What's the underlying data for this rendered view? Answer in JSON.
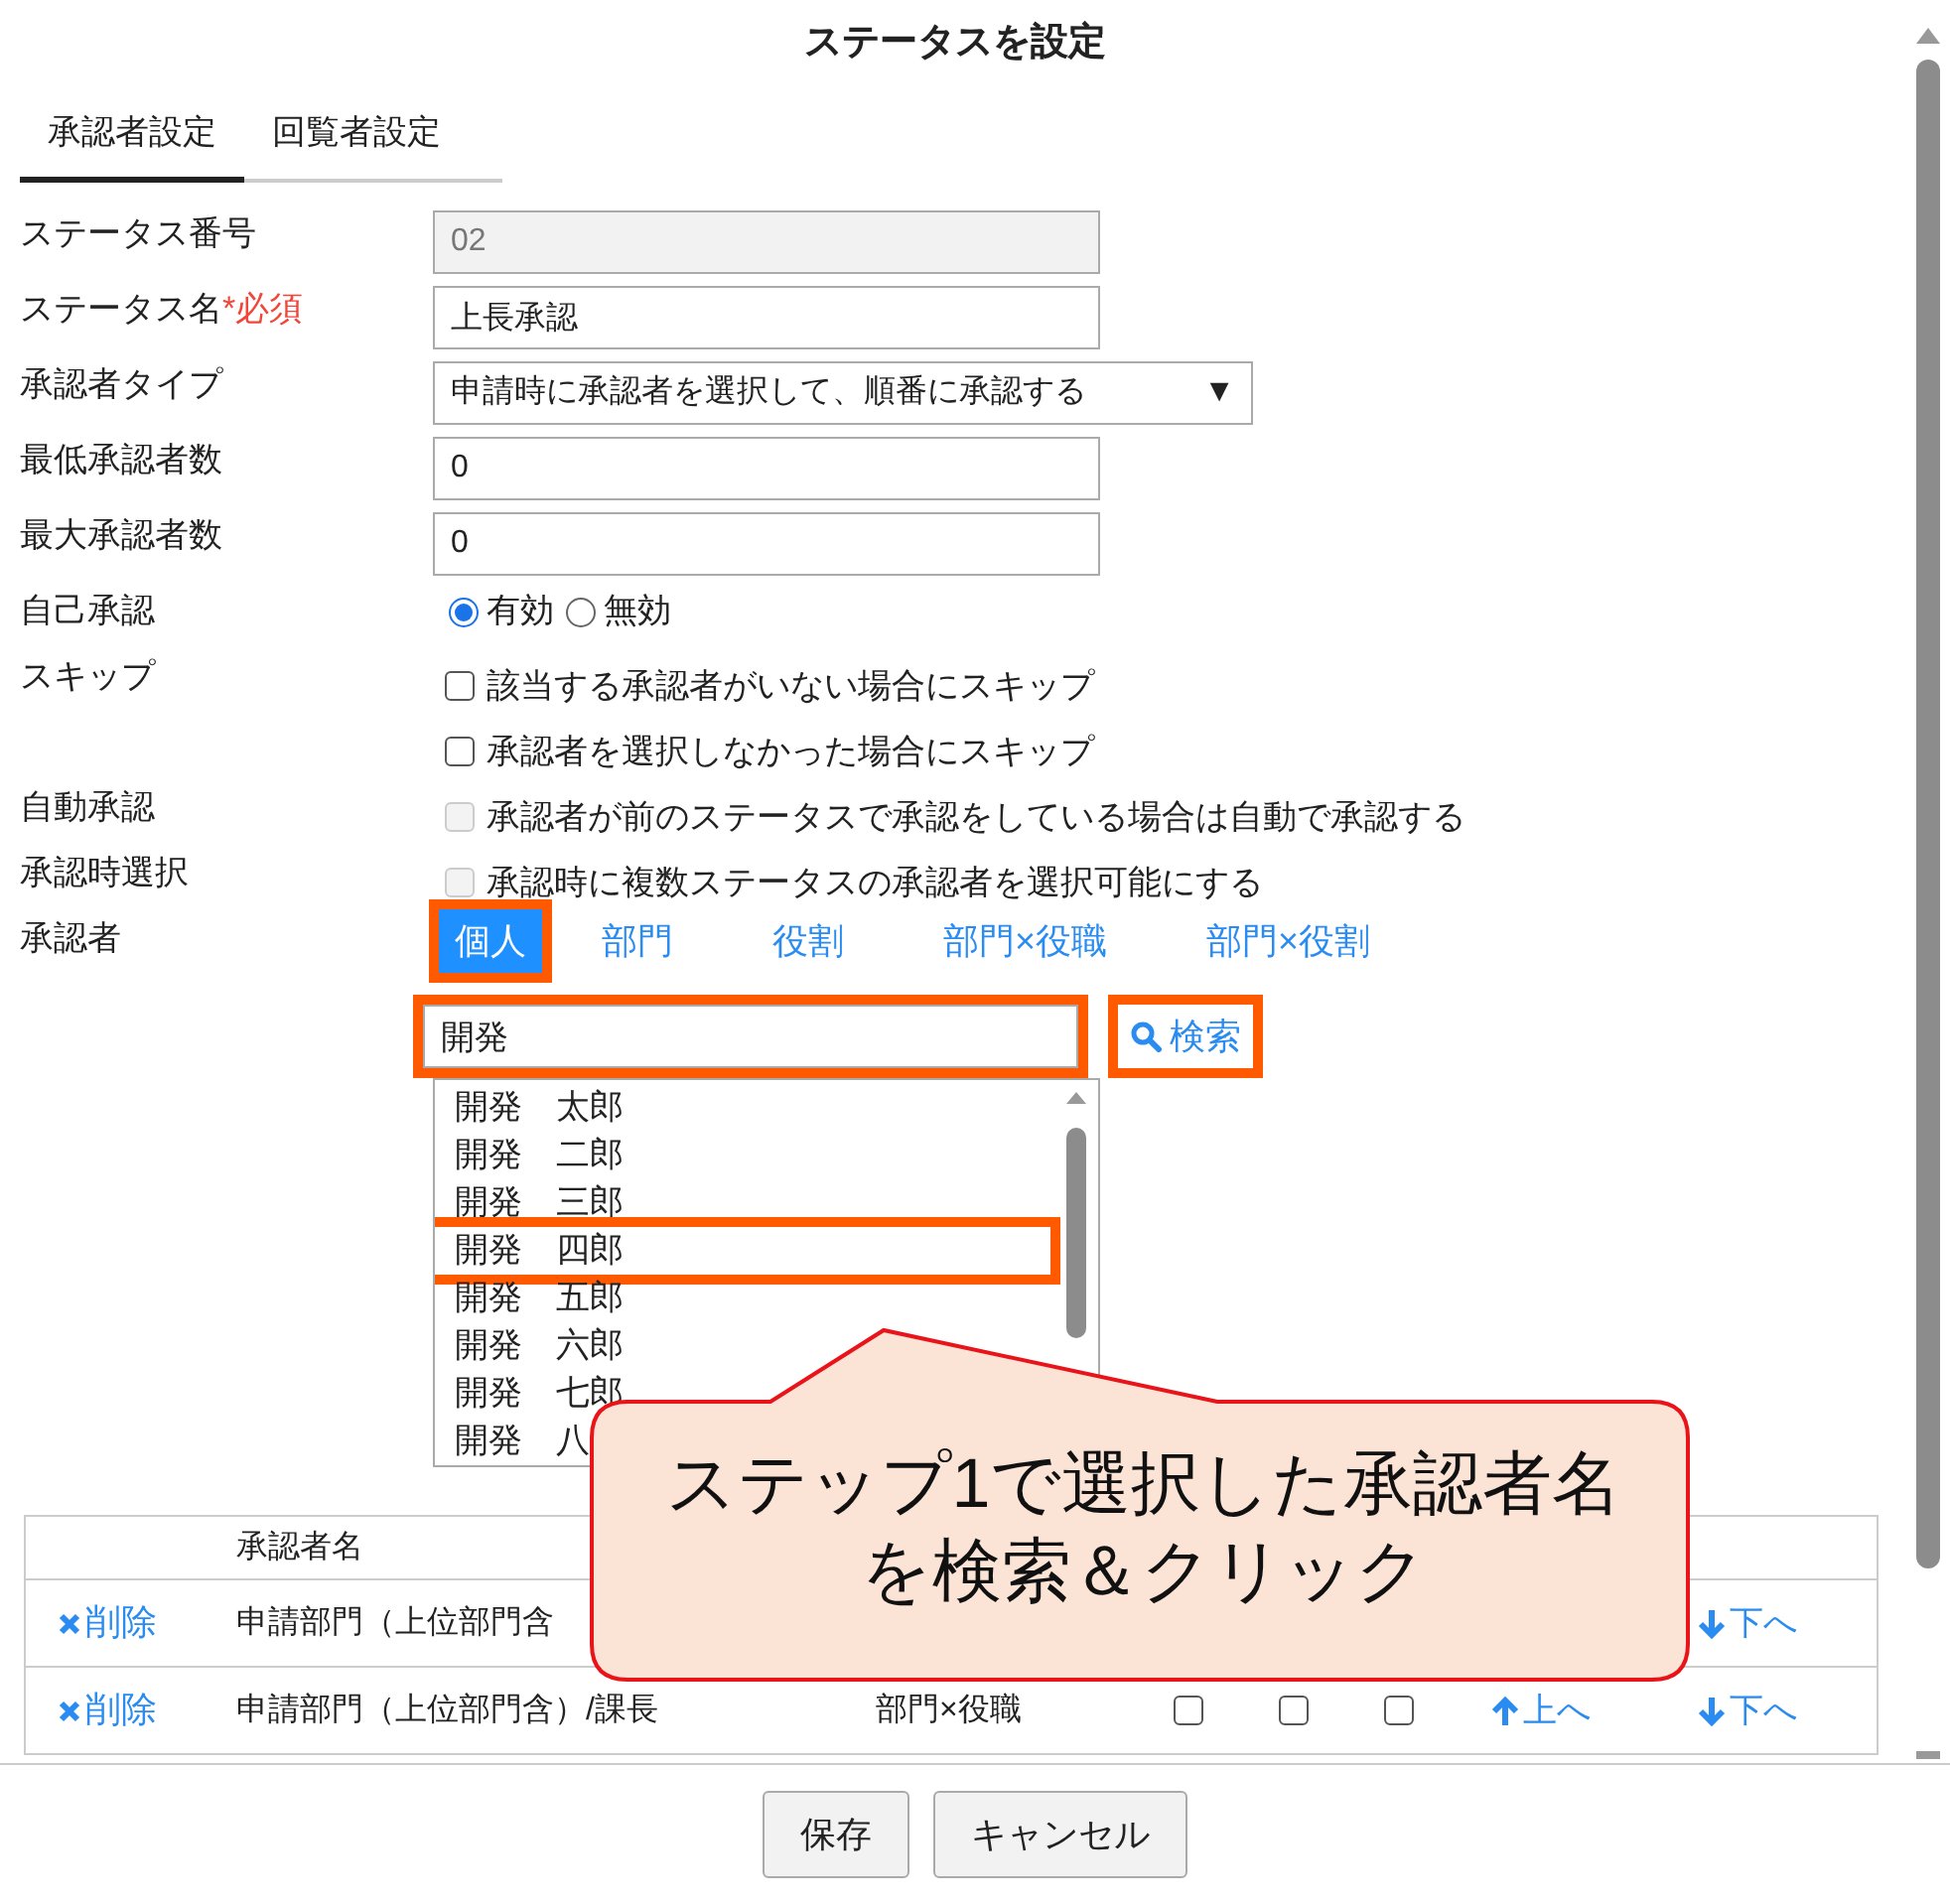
{
  "dialog": {
    "title": "ステータスを設定"
  },
  "tabs": [
    {
      "label": "承認者設定",
      "selected": true
    },
    {
      "label": "回覧者設定",
      "selected": false
    }
  ],
  "fields": [
    {
      "kind": "text",
      "label": "ステータス番号",
      "value": "02",
      "disabled": true
    },
    {
      "kind": "text",
      "label": "ステータス名",
      "required_mark": "*必須",
      "value": "上長承認",
      "disabled": false
    },
    {
      "kind": "select",
      "label": "承認者タイプ",
      "value": "申請時に承認者を選択して、順番に承認する",
      "arrow": "▼"
    },
    {
      "kind": "text",
      "label": "最低承認者数",
      "value": "0",
      "disabled": false
    },
    {
      "kind": "text",
      "label": "最大承認者数",
      "value": "0",
      "disabled": false
    },
    {
      "kind": "radio",
      "label": "自己承認",
      "options": [
        {
          "label": "有効",
          "selected": true
        },
        {
          "label": "無効",
          "selected": false
        }
      ]
    },
    {
      "kind": "checks",
      "label": "スキップ",
      "options": [
        {
          "label": "該当する承認者がいない場合にスキップ",
          "checked": false,
          "disabled": false
        },
        {
          "label": "承認者を選択しなかった場合にスキップ",
          "checked": false,
          "disabled": false
        }
      ]
    },
    {
      "kind": "checks",
      "label": "自動承認",
      "options": [
        {
          "label": "承認者が前のステータスで承認をしている場合は自動で承認する",
          "checked": false,
          "disabled": true
        }
      ]
    },
    {
      "kind": "checks",
      "label": "承認時選択",
      "options": [
        {
          "label": "承認時に複数ステータスの承認者を選択可能にする",
          "checked": false,
          "disabled": true
        }
      ]
    }
  ],
  "approver": {
    "label": "承認者",
    "tabs": [
      {
        "label": "個人",
        "selected": true,
        "highlighted": true
      },
      {
        "label": "部門",
        "selected": false,
        "highlighted": false
      },
      {
        "label": "役割",
        "selected": false,
        "highlighted": false
      },
      {
        "label": "部門×役職",
        "selected": false,
        "highlighted": false
      },
      {
        "label": "部門×役割",
        "selected": false,
        "highlighted": false
      }
    ],
    "search": {
      "value": "開発",
      "highlighted": true
    },
    "search_button": {
      "label": "検索",
      "highlighted": true
    },
    "results": [
      {
        "label": "開発　太郎",
        "highlighted": false
      },
      {
        "label": "開発　二郎",
        "highlighted": false
      },
      {
        "label": "開発　三郎",
        "highlighted": false
      },
      {
        "label": "開発　四郎",
        "highlighted": true
      },
      {
        "label": "開発　五郎",
        "highlighted": false
      },
      {
        "label": "開発　六郎",
        "highlighted": false
      },
      {
        "label": "開発　七郎",
        "highlighted": false
      },
      {
        "label": "開発　八",
        "highlighted": false
      }
    ]
  },
  "table": {
    "columns": [
      "承認者名"
    ],
    "rows": [
      {
        "delete": "削除",
        "name": "申請部門（上位部門含",
        "type": "",
        "checks": [],
        "up": "",
        "down": "下へ"
      },
      {
        "delete": "削除",
        "name": "申請部門（上位部門含）/課長",
        "type": "部門×役職",
        "checks": [
          false,
          false,
          false
        ],
        "up": "上へ",
        "down": "下へ"
      }
    ]
  },
  "buttons": [
    "保存",
    "キャンセル"
  ],
  "callout": {
    "text": "ステップ1で選択した承認者名を検索＆クリック"
  }
}
